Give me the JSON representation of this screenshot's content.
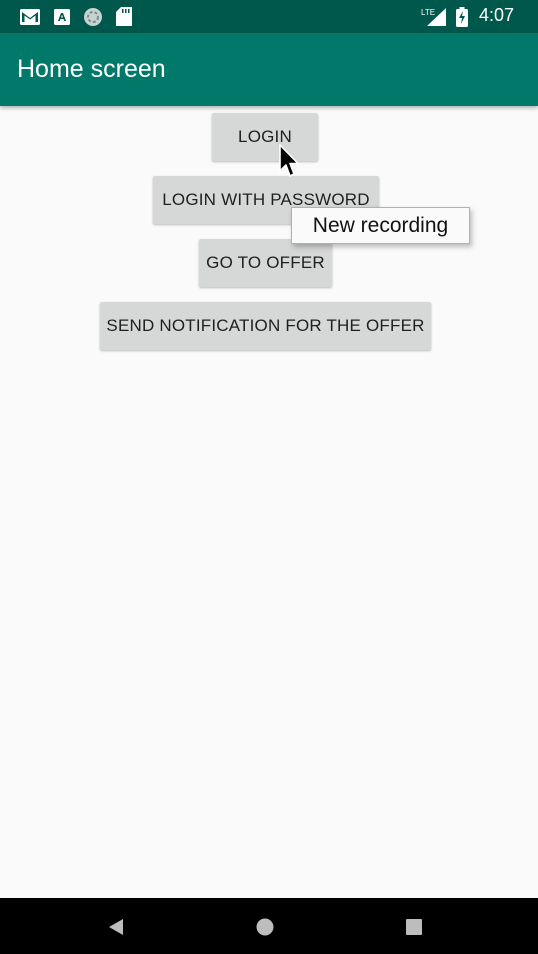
{
  "status_bar": {
    "time": "4:07",
    "left_icons": [
      "gmail-icon",
      "font-a-icon",
      "sync-circle-icon",
      "sd-card-icon"
    ],
    "right_icons": [
      "lte-signal-icon",
      "battery-charging-icon"
    ],
    "lte_label": "LTE"
  },
  "app_bar": {
    "title": "Home screen",
    "color": "#00796b",
    "status_color": "#00574b"
  },
  "buttons": {
    "login": "LOGIN",
    "login_with_password": "LOGIN WITH PASSWORD",
    "go_to_offer": "GO TO OFFER",
    "send_notification": "SEND NOTIFICATION FOR THE OFFER"
  },
  "tooltip": {
    "text": "New recording"
  },
  "nav_bar": {
    "icons": [
      "back-icon",
      "home-icon",
      "recents-icon"
    ]
  }
}
